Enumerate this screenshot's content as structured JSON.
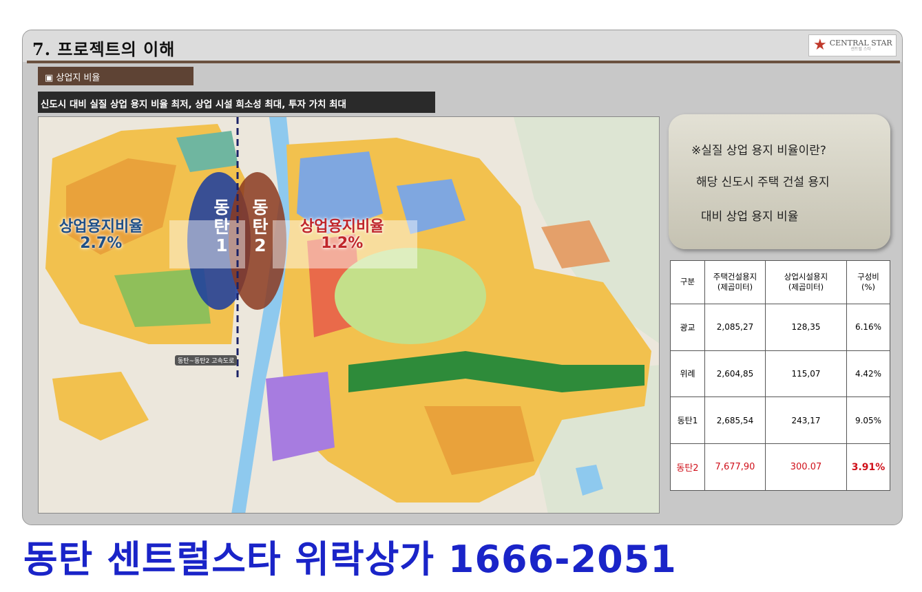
{
  "slide": {
    "title": "7. 프로젝트의 이해",
    "section_tag": "▣ 상업지 비율",
    "headline": "신도시 대비 실질 상업 용지 비율 최저, 상업 시설 희소성 최대, 투자 가치 최대",
    "logo": {
      "name": "CENTRAL STAR",
      "sub": "센트럴 스타"
    }
  },
  "map": {
    "left_label": {
      "line1": "상업용지비율",
      "line2": "2.7%"
    },
    "right_label": {
      "line1": "상업용지비율",
      "line2": "1.2%"
    },
    "dongtan1": {
      "l1": "동",
      "l2": "탄",
      "l3": "1"
    },
    "dongtan2": {
      "l1": "동",
      "l2": "탄",
      "l3": "2"
    },
    "road": "동탄~동탄2 고속도로"
  },
  "info": {
    "line1": "※실질 상업 용지 비율이란?",
    "line2": "해당 신도시 주택 건설 용지",
    "line3": "대비   상업 용지 비율"
  },
  "table": {
    "headers": [
      "구분",
      "주택건설용지\n(제곱미터)",
      "상업시설용지\n(제곱미터)",
      "구성비\n(%)"
    ],
    "rows": [
      [
        "광교",
        "2,085,27",
        "128,35",
        "6.16%"
      ],
      [
        "위례",
        "2,604,85",
        "115,07",
        "4.42%"
      ],
      [
        "동탄1",
        "2,685,54",
        "243,17",
        "9.05%"
      ],
      [
        "동탄2",
        "7,677,90",
        "300.07",
        "3.91%"
      ]
    ]
  },
  "footer": "동탄 센트럴스타 위락상가  1666-2051"
}
